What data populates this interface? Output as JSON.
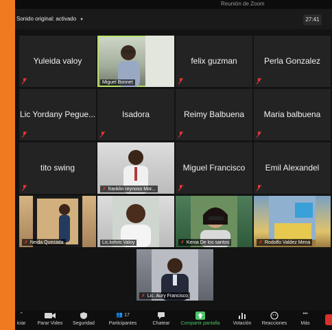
{
  "window": {
    "title": "Reunión de Zoom"
  },
  "topbar": {
    "sound_label": "Sonido original: activado",
    "timer": "27:41"
  },
  "participants": [
    {
      "name": "Yuleida valoy",
      "video": false
    },
    {
      "name": "Miguel Bonnet",
      "video": true,
      "active": true
    },
    {
      "name": "felix guzman",
      "video": false
    },
    {
      "name": "Perla Gonzalez",
      "video": false
    },
    {
      "name": "Lic Yordany Pegue...",
      "video": false
    },
    {
      "name": "Isadora",
      "video": false
    },
    {
      "name": "Reimy Balbuena",
      "video": false
    },
    {
      "name": "Maria balbuena",
      "video": false
    },
    {
      "name": "tito swing",
      "video": false
    },
    {
      "name": "franklin reynoso Mor...",
      "video": true
    },
    {
      "name": "Miguel Francisco",
      "video": false
    },
    {
      "name": "Emil Alexandel",
      "video": false
    },
    {
      "name": "Neida Quezada",
      "video": true
    },
    {
      "name": "Lic.kelvis Valoy",
      "video": true
    },
    {
      "name": "Kenia De los santos",
      "video": true
    },
    {
      "name": "Rodolfo Valdez Mena",
      "video": true
    },
    {
      "name": "Lic. Aury Francisco",
      "video": true
    }
  ],
  "toolbar": {
    "partial_left": "iciar",
    "video": "Parar Video",
    "security": "Seguridad",
    "participants": "Participantes",
    "participants_count": "17",
    "chat": "Chatear",
    "share": "Compartir pantalla",
    "poll": "Votación",
    "reactions": "Reacciones",
    "more": "Más"
  },
  "colors": {
    "accent_active": "#b6e36a",
    "share_green": "#4cc36b",
    "muted_red": "#e53935",
    "end_red": "#d9302b"
  },
  "icons": [
    "microphone-muted-icon",
    "video-camera-icon",
    "shield-icon",
    "people-icon",
    "chat-bubble-icon",
    "share-screen-icon",
    "poll-bars-icon",
    "reaction-emoji-icon",
    "more-dots-icon",
    "chevron-up-icon",
    "chevron-down-icon"
  ]
}
